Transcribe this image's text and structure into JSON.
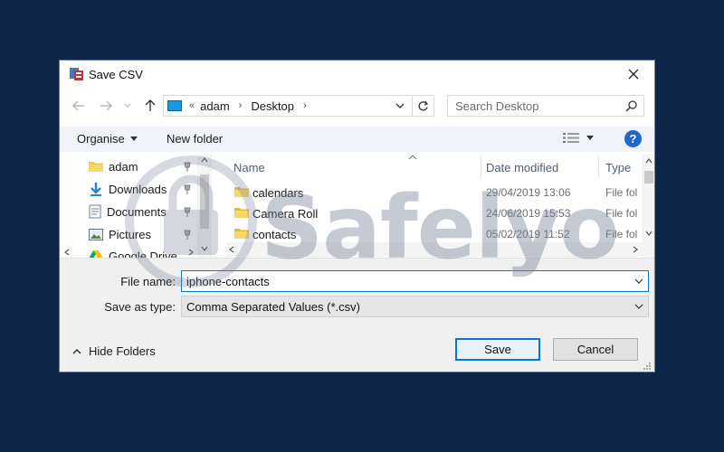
{
  "dialog": {
    "title": "Save CSV"
  },
  "address": {
    "overflow": "«",
    "crumbs": [
      "adam",
      "Desktop"
    ],
    "search_placeholder": "Search Desktop"
  },
  "toolbar": {
    "organise_label": "Organise",
    "new_folder_label": "New folder",
    "help_label": "?"
  },
  "nav": {
    "items": [
      {
        "label": "adam",
        "icon": "folder-icon"
      },
      {
        "label": "Downloads",
        "icon": "download-arrow-icon"
      },
      {
        "label": "Documents",
        "icon": "documents-icon"
      },
      {
        "label": "Pictures",
        "icon": "pictures-icon"
      },
      {
        "label": "Google Drive",
        "icon": "google-drive-icon"
      }
    ]
  },
  "files": {
    "columns": [
      "Name",
      "Date modified",
      "Type"
    ],
    "rows": [
      {
        "name": "calendars",
        "date": "29/04/2019 13:06",
        "type": "File fol"
      },
      {
        "name": "Camera Roll",
        "date": "24/06/2019 15:53",
        "type": "File fol"
      },
      {
        "name": "contacts",
        "date": "05/02/2019 11:52",
        "type": "File fol"
      }
    ]
  },
  "form": {
    "file_name_label": "File name:",
    "file_name_value": "iphone-contacts",
    "save_type_label": "Save as type:",
    "save_type_value": "Comma Separated Values (*.csv)"
  },
  "footer": {
    "hide_folders_label": "Hide Folders",
    "save_label": "Save",
    "cancel_label": "Cancel"
  },
  "watermark": {
    "text": "Safelyo"
  },
  "colors": {
    "background": "#0d2547",
    "accent": "#0078d7",
    "help": "#1f67c8",
    "folder": "#f3c94d"
  }
}
